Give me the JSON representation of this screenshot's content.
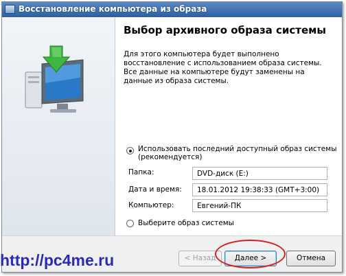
{
  "window": {
    "title": "Восстановление компьютера из образа"
  },
  "page": {
    "heading": "Выбор архивного образа системы",
    "description": "Для этого компьютера будет выполнено восстановление с использованием образа системы. Все данные на компьютере будут заменены на данные из образа системы."
  },
  "options": {
    "use_latest": {
      "label_line1": "Использовать последний доступный образ системы",
      "label_line2": "(рекомендуется)",
      "checked": true
    },
    "select_image": {
      "label": "Выберите образ системы",
      "checked": false
    }
  },
  "fields": [
    {
      "label": "Папка:",
      "value": "DVD-диск (E:)"
    },
    {
      "label": "Дата и время:",
      "value": "18.01.2012 19:38:33 (GMT+3:00)"
    },
    {
      "label": "Компьютер:",
      "value": "Евгений-ПК"
    }
  ],
  "buttons": {
    "back": "< Назад",
    "next": "Далее >",
    "cancel": "Отмена"
  },
  "watermark": "http://pc4me.ru",
  "colors": {
    "annotation": "#d62020",
    "watermark": "#2a2ab8",
    "titlebar": "#2d5f9f"
  }
}
